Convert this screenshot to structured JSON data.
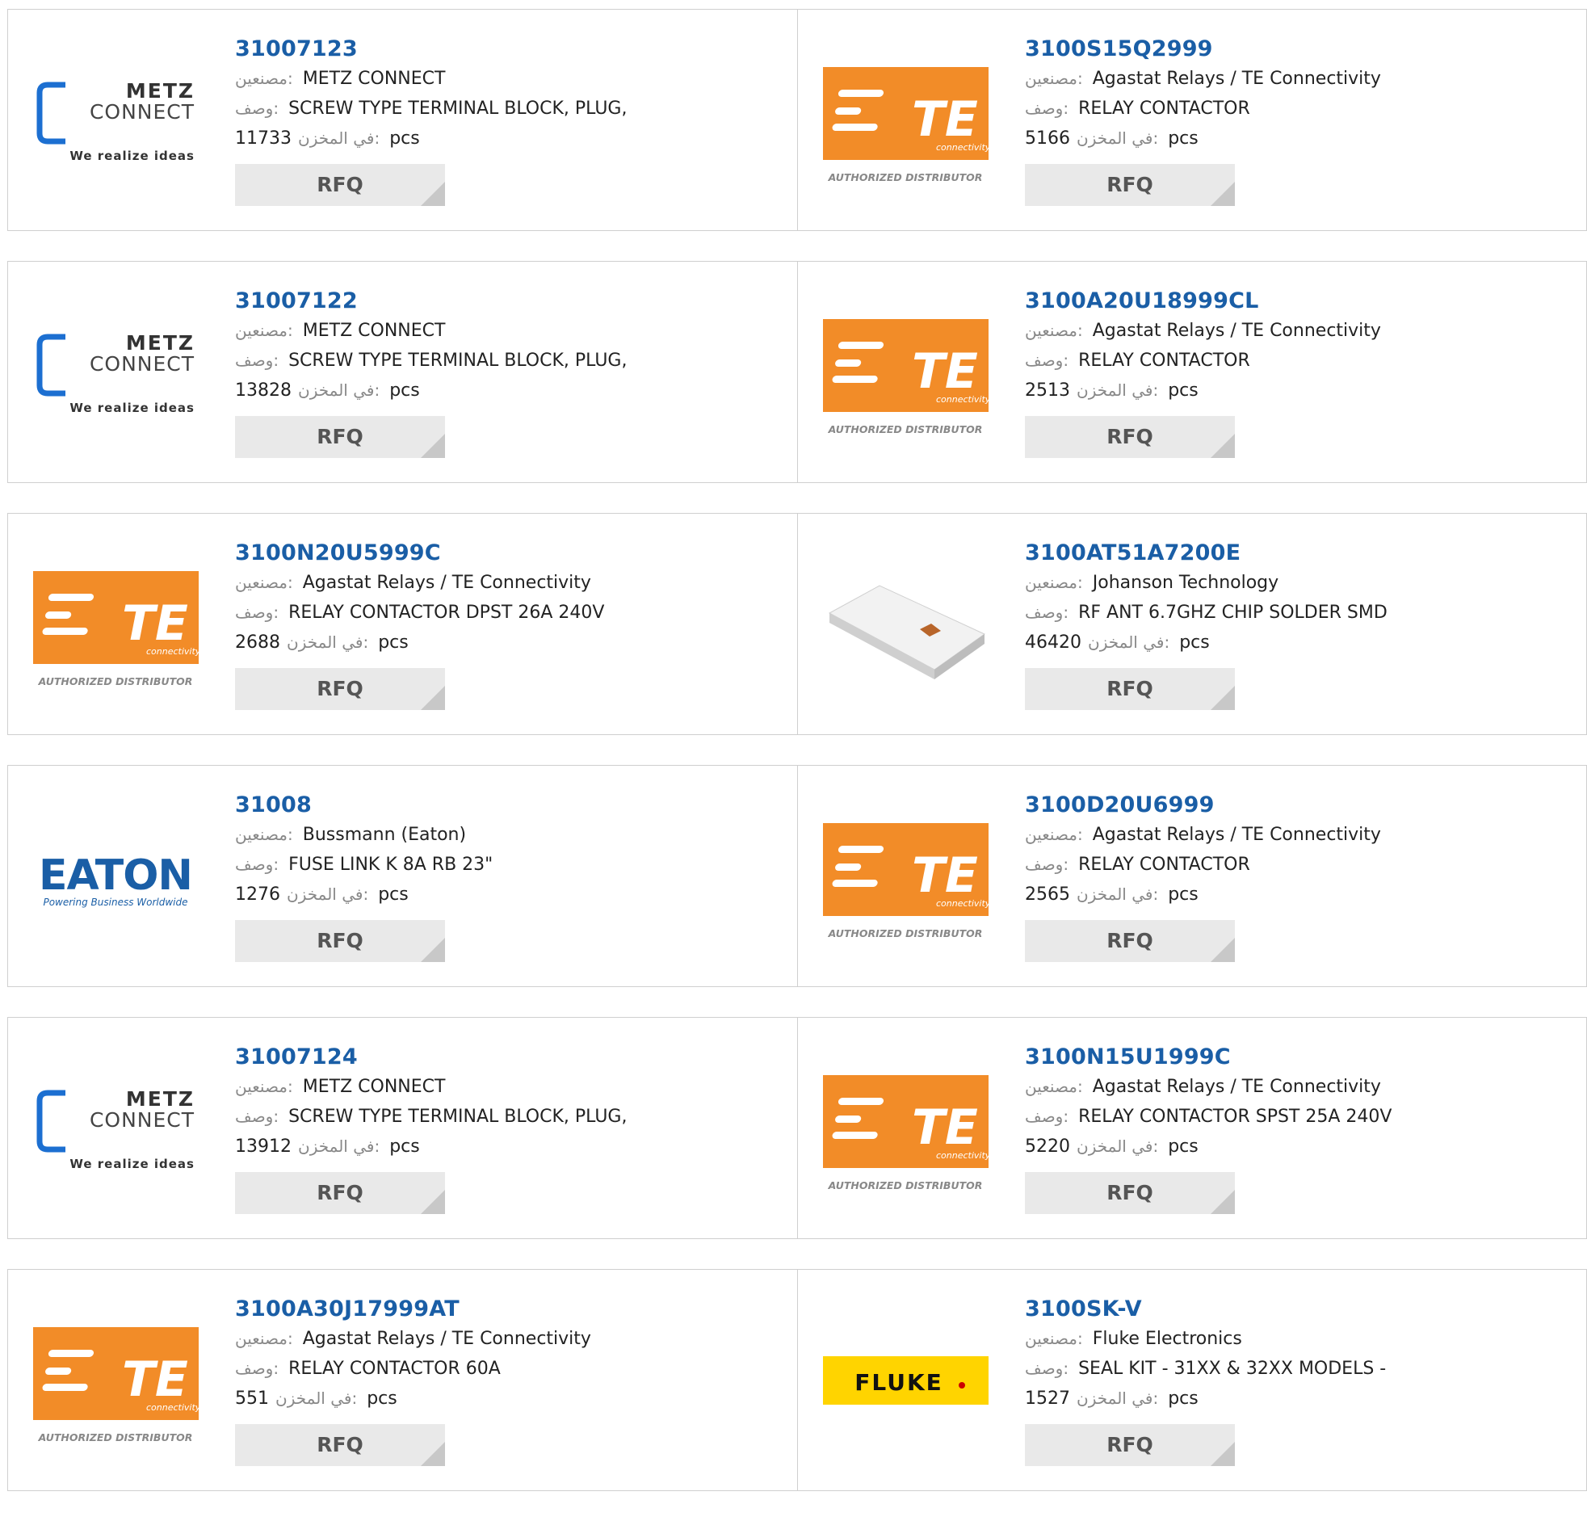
{
  "labels": {
    "manufacturer": "مصنعين:",
    "description": "وصف:",
    "in_stock": "في المخزن:",
    "unit": "pcs",
    "rfq": "RFQ"
  },
  "products": [
    {
      "part": "31007123",
      "manufacturer": "METZ CONNECT",
      "description": "SCREW TYPE TERMINAL BLOCK, PLUG,",
      "stock": "11733",
      "logo": "metz"
    },
    {
      "part": "3100S15Q2999",
      "manufacturer": "Agastat Relays / TE Connectivity",
      "description": "RELAY CONTACTOR",
      "stock": "5166",
      "logo": "te"
    },
    {
      "part": "31007122",
      "manufacturer": "METZ CONNECT",
      "description": "SCREW TYPE TERMINAL BLOCK, PLUG,",
      "stock": "13828",
      "logo": "metz"
    },
    {
      "part": "3100A20U18999CL",
      "manufacturer": "Agastat Relays / TE Connectivity",
      "description": "RELAY CONTACTOR",
      "stock": "2513",
      "logo": "te"
    },
    {
      "part": "3100N20U5999C",
      "manufacturer": "Agastat Relays / TE Connectivity",
      "description": "RELAY CONTACTOR DPST 26A 240V",
      "stock": "2688",
      "logo": "te"
    },
    {
      "part": "3100AT51A7200E",
      "manufacturer": "Johanson Technology",
      "description": "RF ANT 6.7GHZ CHIP SOLDER SMD",
      "stock": "46420",
      "logo": "chip"
    },
    {
      "part": "31008",
      "manufacturer": "Bussmann (Eaton)",
      "description": "FUSE LINK K 8A RB 23\"",
      "stock": "1276",
      "logo": "eaton"
    },
    {
      "part": "3100D20U6999",
      "manufacturer": "Agastat Relays / TE Connectivity",
      "description": "RELAY CONTACTOR",
      "stock": "2565",
      "logo": "te"
    },
    {
      "part": "31007124",
      "manufacturer": "METZ CONNECT",
      "description": "SCREW TYPE TERMINAL BLOCK, PLUG,",
      "stock": "13912",
      "logo": "metz"
    },
    {
      "part": "3100N15U1999C",
      "manufacturer": "Agastat Relays / TE Connectivity",
      "description": "RELAY CONTACTOR SPST 25A 240V",
      "stock": "5220",
      "logo": "te"
    },
    {
      "part": "3100A30J17999AT",
      "manufacturer": "Agastat Relays / TE Connectivity",
      "description": "RELAY CONTACTOR 60A",
      "stock": "551",
      "logo": "te"
    },
    {
      "part": "3100SK-V",
      "manufacturer": "Fluke Electronics",
      "description": "SEAL KIT - 31XX & 32XX MODELS -",
      "stock": "1527",
      "logo": "fluke"
    }
  ],
  "logos": {
    "metz": {
      "line1": "METZ",
      "line2": "CONNECT",
      "tagline": "We realize ideas",
      "color": "#1c6fd1"
    },
    "te": {
      "mark": "TE",
      "sub": "connectivity",
      "caption": "AUTHORIZED DISTRIBUTOR",
      "color": "#f28c28"
    },
    "eaton": {
      "mark": "EATON",
      "tagline": "Powering Business Worldwide",
      "color": "#1a5ea6"
    },
    "fluke": {
      "mark": "FLUKE",
      "color": "#ffd400"
    },
    "chip": {
      "color": "#e6e6e6"
    }
  }
}
